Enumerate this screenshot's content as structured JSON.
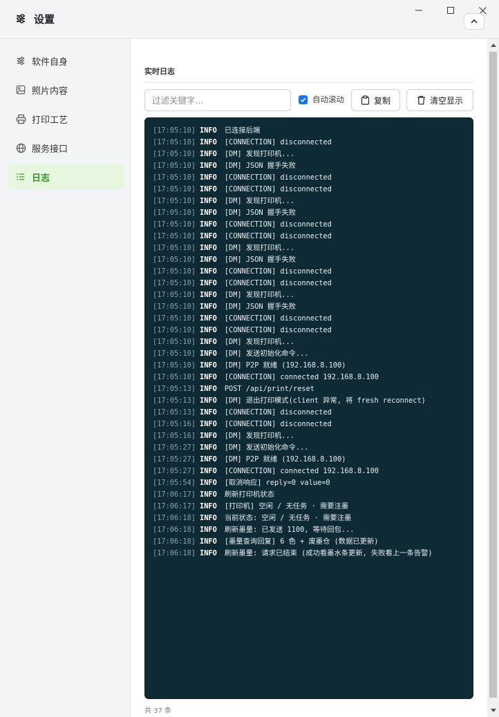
{
  "header": {
    "title": "设置"
  },
  "sidebar": {
    "items": [
      {
        "label": "软件自身",
        "icon": "sliders-icon"
      },
      {
        "label": "照片内容",
        "icon": "image-icon"
      },
      {
        "label": "打印工艺",
        "icon": "printer-icon"
      },
      {
        "label": "服务接口",
        "icon": "globe-icon"
      },
      {
        "label": "日志",
        "icon": "list-icon",
        "active": true
      }
    ]
  },
  "main": {
    "section_title": "实时日志",
    "filter_placeholder": "过滤关键字...",
    "autoscroll_label": "自动滚动",
    "autoscroll_checked": true,
    "copy_label": "复制",
    "clear_label": "清空显示",
    "count_text": "共 37 条"
  },
  "logs": [
    {
      "ts": "[17:05:10]",
      "level": "INFO",
      "msg": "已连接后端"
    },
    {
      "ts": "[17:05:10]",
      "level": "INFO",
      "msg": "[CONNECTION] disconnected"
    },
    {
      "ts": "[17:05:10]",
      "level": "INFO",
      "msg": "[DM] 发现打印机..."
    },
    {
      "ts": "[17:05:10]",
      "level": "INFO",
      "msg": "[DM] JSON 握手失败"
    },
    {
      "ts": "[17:05:10]",
      "level": "INFO",
      "msg": "[CONNECTION] disconnected"
    },
    {
      "ts": "[17:05:10]",
      "level": "INFO",
      "msg": "[CONNECTION] disconnected"
    },
    {
      "ts": "[17:05:10]",
      "level": "INFO",
      "msg": "[DM] 发现打印机..."
    },
    {
      "ts": "[17:05:10]",
      "level": "INFO",
      "msg": "[DM] JSON 握手失败"
    },
    {
      "ts": "[17:05:10]",
      "level": "INFO",
      "msg": "[CONNECTION] disconnected"
    },
    {
      "ts": "[17:05:10]",
      "level": "INFO",
      "msg": "[CONNECTION] disconnected"
    },
    {
      "ts": "[17:05:10]",
      "level": "INFO",
      "msg": "[DM] 发现打印机..."
    },
    {
      "ts": "[17:05:10]",
      "level": "INFO",
      "msg": "[DM] JSON 握手失败"
    },
    {
      "ts": "[17:05:10]",
      "level": "INFO",
      "msg": "[CONNECTION] disconnected"
    },
    {
      "ts": "[17:05:10]",
      "level": "INFO",
      "msg": "[CONNECTION] disconnected"
    },
    {
      "ts": "[17:05:10]",
      "level": "INFO",
      "msg": "[DM] 发现打印机..."
    },
    {
      "ts": "[17:05:10]",
      "level": "INFO",
      "msg": "[DM] JSON 握手失败"
    },
    {
      "ts": "[17:05:10]",
      "level": "INFO",
      "msg": "[CONNECTION] disconnected"
    },
    {
      "ts": "[17:05:10]",
      "level": "INFO",
      "msg": "[CONNECTION] disconnected"
    },
    {
      "ts": "[17:05:10]",
      "level": "INFO",
      "msg": "[DM] 发现打印机..."
    },
    {
      "ts": "[17:05:10]",
      "level": "INFO",
      "msg": "[DM] 发送初始化命令..."
    },
    {
      "ts": "[17:05:10]",
      "level": "INFO",
      "msg": "[DM] P2P 就绪 (192.168.8.100)"
    },
    {
      "ts": "[17:05:10]",
      "level": "INFO",
      "msg": "[CONNECTION] connected 192.168.8.100"
    },
    {
      "ts": "[17:05:13]",
      "level": "INFO",
      "msg": "POST /api/print/reset"
    },
    {
      "ts": "[17:05:13]",
      "level": "INFO",
      "msg": "[DM] 退出打印模式(client 异常, 将 fresh reconnect)"
    },
    {
      "ts": "[17:05:13]",
      "level": "INFO",
      "msg": "[CONNECTION] disconnected"
    },
    {
      "ts": "[17:05:16]",
      "level": "INFO",
      "msg": "[CONNECTION] disconnected"
    },
    {
      "ts": "[17:05:16]",
      "level": "INFO",
      "msg": "[DM] 发现打印机..."
    },
    {
      "ts": "[17:05:27]",
      "level": "INFO",
      "msg": "[DM] 发送初始化命令..."
    },
    {
      "ts": "[17:05:27]",
      "level": "INFO",
      "msg": "[DM] P2P 就绪 (192.168.8.100)"
    },
    {
      "ts": "[17:05:27]",
      "level": "INFO",
      "msg": "[CONNECTION] connected 192.168.8.100"
    },
    {
      "ts": "[17:05:54]",
      "level": "INFO",
      "msg": "[取消响应] reply=0 value=0"
    },
    {
      "ts": "[17:06:17]",
      "level": "INFO",
      "msg": "刷新打印机状态"
    },
    {
      "ts": "[17:06:17]",
      "level": "INFO",
      "msg": "[打印机] 空闲 / 无任务 · 需要注墨"
    },
    {
      "ts": "[17:06:18]",
      "level": "INFO",
      "msg": "当前状态: 空闲 / 无任务 · 需要注墨"
    },
    {
      "ts": "[17:06:18]",
      "level": "INFO",
      "msg": "刷新墨量: 已发送 1100, 等待回包..."
    },
    {
      "ts": "[17:06:18]",
      "level": "INFO",
      "msg": "[墨量查询回复] 6 色 + 废墨仓 (数据已更新)"
    },
    {
      "ts": "[17:06:18]",
      "level": "INFO",
      "msg": "刷新墨量: 请求已结束 (成功看墨水条更新, 失败看上一条告警)"
    }
  ]
}
